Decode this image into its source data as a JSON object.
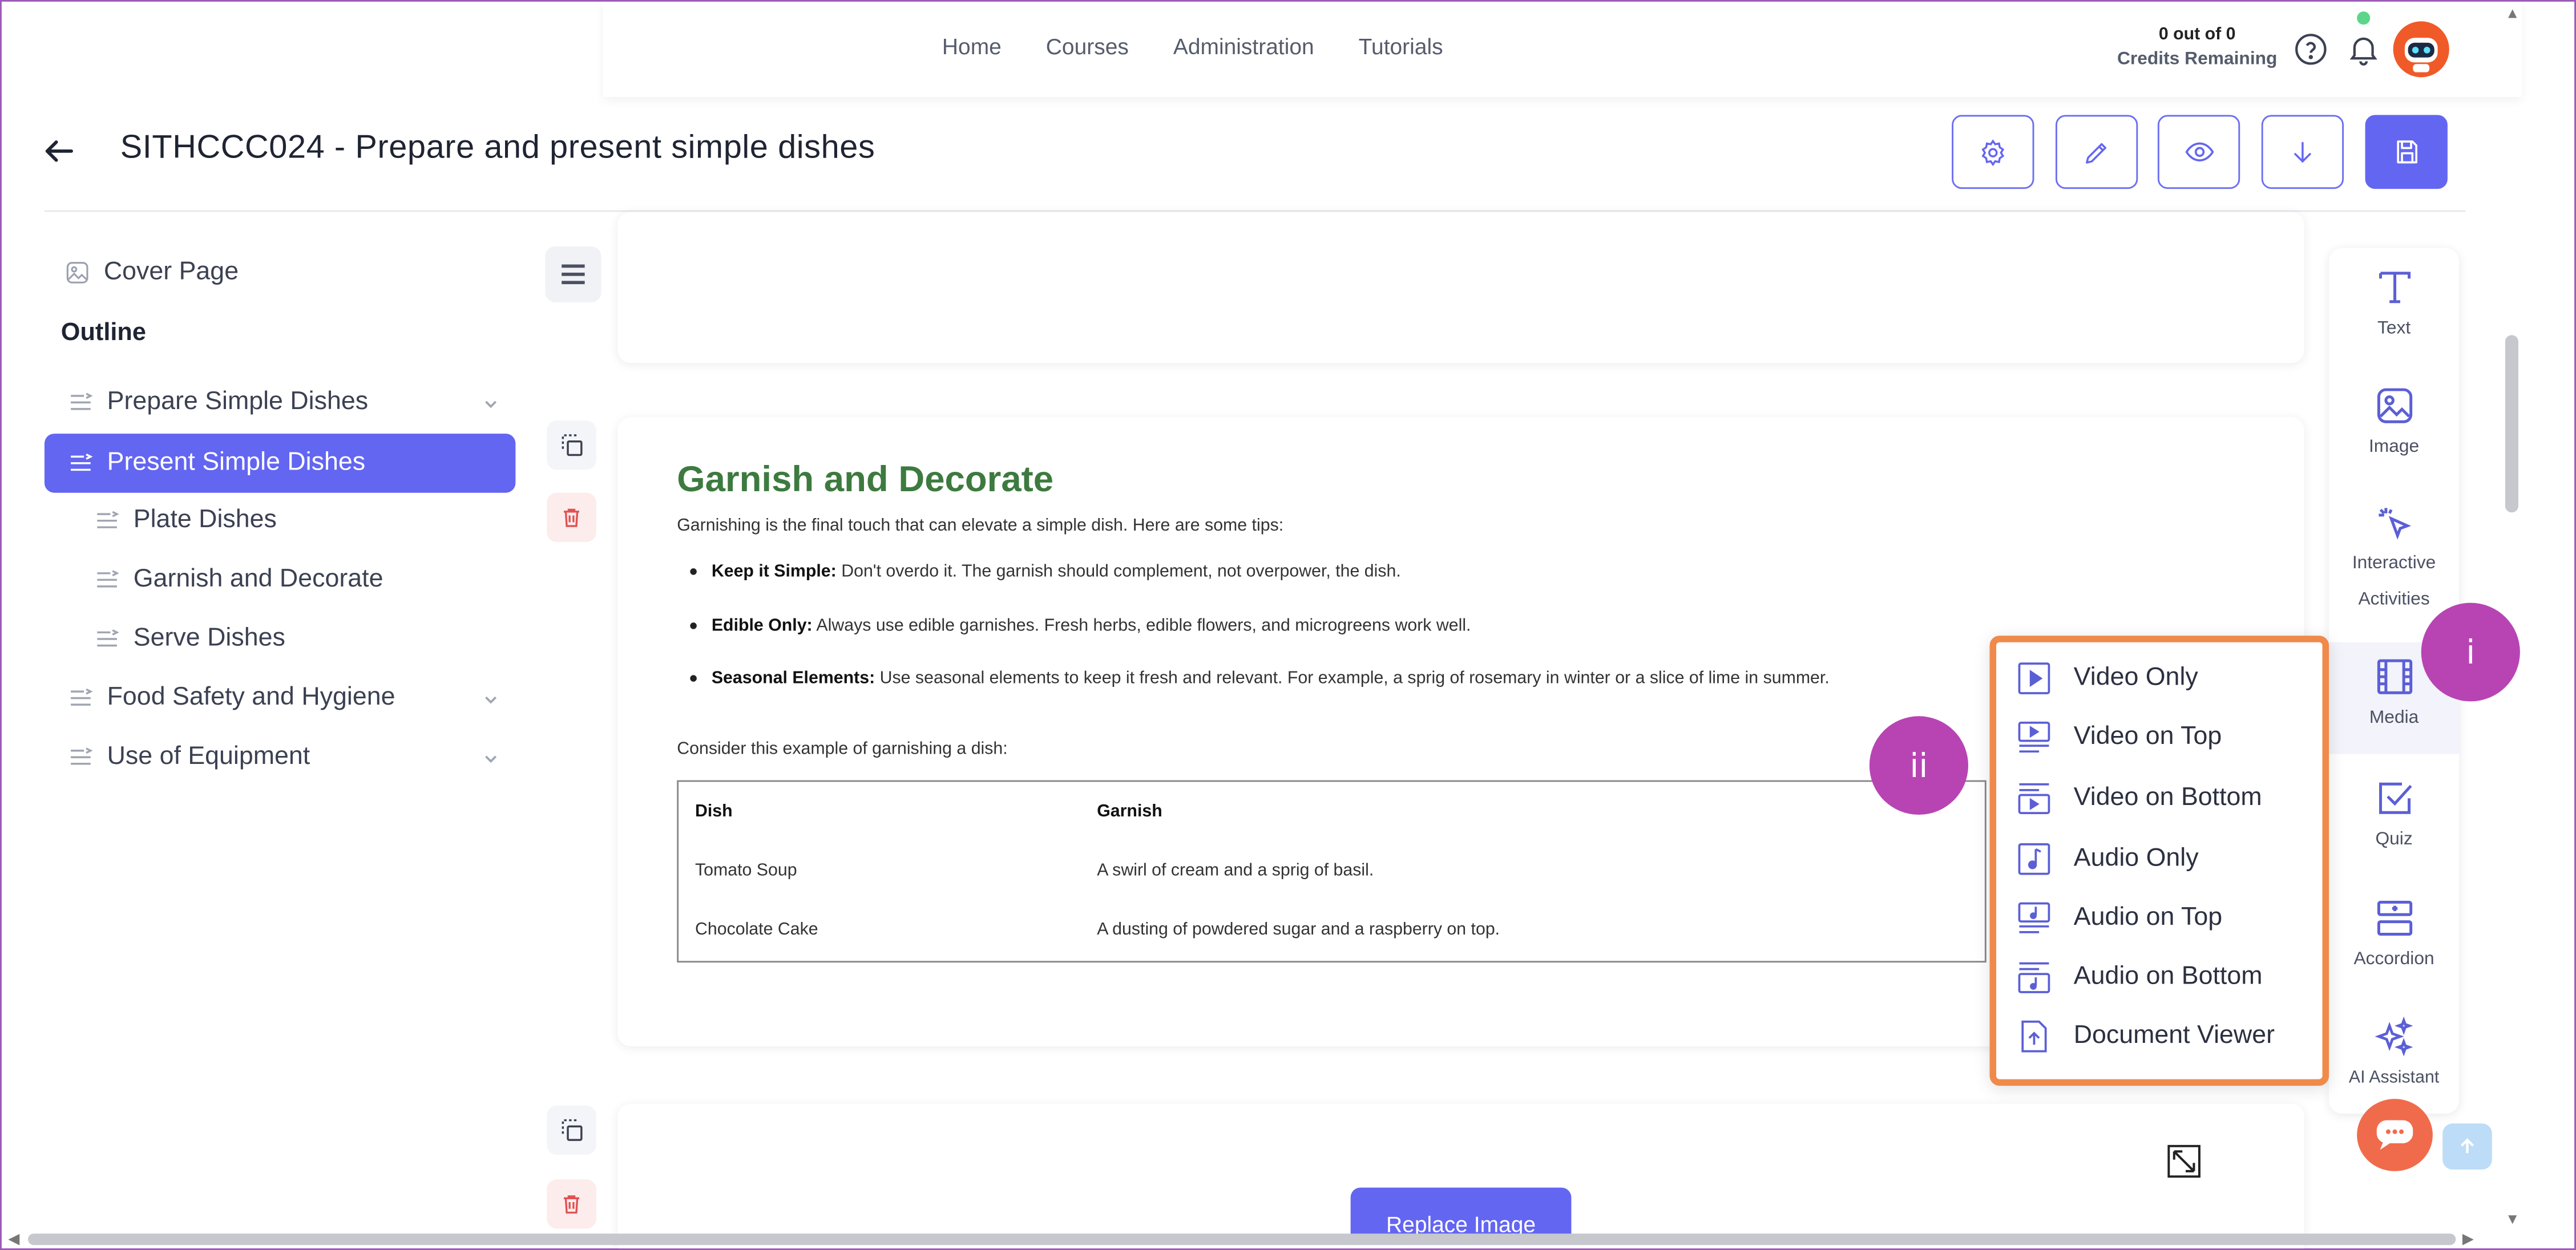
{
  "nav": {
    "links": [
      "Home",
      "Courses",
      "Administration",
      "Tutorials"
    ],
    "credits_count": "0 out of 0",
    "credits_label": "Credits Remaining"
  },
  "header": {
    "title": "SITHCCC024 - Prepare and present simple dishes"
  },
  "sidebar": {
    "cover_page": "Cover Page",
    "outline_label": "Outline",
    "items": [
      {
        "label": "Prepare Simple Dishes",
        "level": 0,
        "expandable": true,
        "active": false
      },
      {
        "label": "Present Simple Dishes",
        "level": 0,
        "expandable": false,
        "active": true
      },
      {
        "label": "Plate Dishes",
        "level": 1,
        "expandable": false,
        "active": false
      },
      {
        "label": "Garnish and Decorate",
        "level": 1,
        "expandable": false,
        "active": false
      },
      {
        "label": "Serve Dishes",
        "level": 1,
        "expandable": false,
        "active": false
      },
      {
        "label": "Food Safety and Hygiene",
        "level": 0,
        "expandable": true,
        "active": false
      },
      {
        "label": "Use of Equipment",
        "level": 0,
        "expandable": true,
        "active": false
      }
    ]
  },
  "content": {
    "section_title": "Garnish and Decorate",
    "intro": "Garnishing is the final touch that can elevate a simple dish. Here are some tips:",
    "bullets": [
      {
        "bold": "Keep it Simple:",
        "text": " Don't overdo it. The garnish should complement, not overpower, the dish."
      },
      {
        "bold": "Edible Only:",
        "text": " Always use edible garnishes. Fresh herbs, edible flowers, and microgreens work well."
      },
      {
        "bold": "Seasonal Elements:",
        "text": " Use seasonal elements to keep it fresh and relevant. For example, a sprig of rosemary in winter or a slice of lime in summer."
      }
    ],
    "example_text": "Consider this example of garnishing a dish:",
    "table": {
      "headers": [
        "Dish",
        "Garnish"
      ],
      "rows": [
        [
          "Tomato Soup",
          "A swirl of cream and a sprig of basil."
        ],
        [
          "Chocolate Cake",
          "A dusting of powdered sugar and a raspberry on top."
        ]
      ]
    },
    "replace_image_label": "Replace Image"
  },
  "element_panel": {
    "items": [
      "Text",
      "Image",
      "Interactive Activities",
      "Media",
      "Quiz",
      "Accordion",
      "AI Assistant"
    ],
    "interactive_line1": "Interactive",
    "interactive_line2": "Activities"
  },
  "media_menu": {
    "items": [
      "Video Only",
      "Video on Top",
      "Video on Bottom",
      "Audio Only",
      "Audio on Top",
      "Audio on Bottom",
      "Document Viewer"
    ]
  },
  "markers": {
    "first": "i",
    "second": "ii"
  },
  "colors": {
    "accent": "#6366f1",
    "section_title": "#3d7a3f",
    "dropdown_border": "#f08a4b",
    "marker": "#b844b4",
    "delete": "#e05252"
  }
}
